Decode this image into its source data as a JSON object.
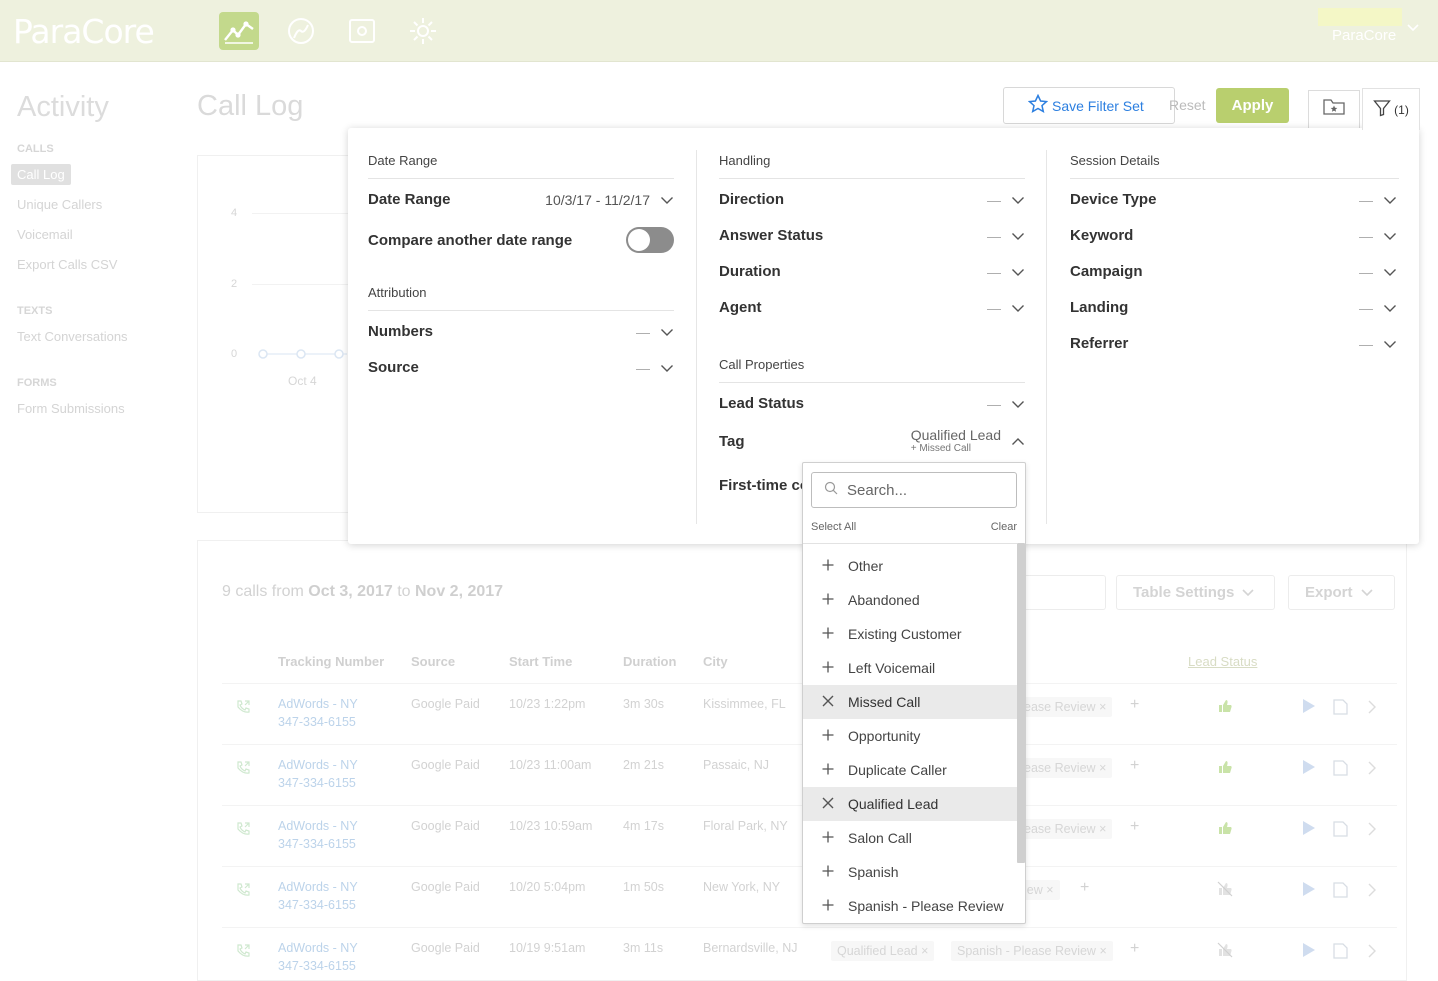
{
  "brand": "ParaCore",
  "account": {
    "name": "ParaCore"
  },
  "sidebar": {
    "title": "Activity",
    "sections": [
      {
        "label": "CALLS",
        "items": [
          "Call Log",
          "Unique Callers",
          "Voicemail",
          "Export Calls CSV"
        ]
      },
      {
        "label": "TEXTS",
        "items": [
          "Text Conversations"
        ]
      },
      {
        "label": "FORMS",
        "items": [
          "Form Submissions"
        ]
      }
    ],
    "active_item": "Call Log"
  },
  "page": {
    "title": "Call Log"
  },
  "toolbar": {
    "save_filter_label": "Save Filter Set",
    "reset_label": "Reset",
    "apply_label": "Apply",
    "filter_count": "(1)"
  },
  "chart": {
    "y_ticks": [
      "4",
      "2",
      "0"
    ],
    "x_ticks": [
      "Oct 4"
    ]
  },
  "filters": {
    "date_range_section": "Date Range",
    "date_range_label": "Date Range",
    "date_range_value": "10/3/17 - 11/2/17",
    "compare_label": "Compare another date range",
    "attribution_section": "Attribution",
    "numbers_label": "Numbers",
    "source_label": "Source",
    "handling_section": "Handling",
    "direction_label": "Direction",
    "answer_status_label": "Answer Status",
    "duration_label": "Duration",
    "agent_label": "Agent",
    "call_props_section": "Call Properties",
    "lead_status_label": "Lead Status",
    "tag_label": "Tag",
    "tag_value": "Qualified Lead",
    "tag_sub": "+ Missed Call",
    "first_time_label": "First-time co",
    "session_section": "Session Details",
    "device_type_label": "Device Type",
    "keyword_label": "Keyword",
    "campaign_label": "Campaign",
    "landing_label": "Landing",
    "referrer_label": "Referrer",
    "empty": "—"
  },
  "tag_dropdown": {
    "search_placeholder": "Search...",
    "select_all": "Select All",
    "clear": "Clear",
    "options": [
      {
        "label": "Other",
        "selected": false
      },
      {
        "label": "Abandoned",
        "selected": false
      },
      {
        "label": "Existing Customer",
        "selected": false
      },
      {
        "label": "Left Voicemail",
        "selected": false
      },
      {
        "label": "Missed Call",
        "selected": true
      },
      {
        "label": "Opportunity",
        "selected": false
      },
      {
        "label": "Duplicate Caller",
        "selected": false
      },
      {
        "label": "Qualified Lead",
        "selected": true
      },
      {
        "label": "Salon Call",
        "selected": false
      },
      {
        "label": "Spanish",
        "selected": false
      },
      {
        "label": "Spanish - Please Review",
        "selected": false
      }
    ]
  },
  "table": {
    "summary_prefix": "9 calls from",
    "summary_start": "Oct 3, 2017",
    "summary_mid": "to",
    "summary_end": "Nov 2, 2017",
    "table_settings_label": "Table Settings",
    "export_label": "Export",
    "columns": [
      "Tracking Number",
      "Source",
      "Start Time",
      "Duration",
      "City",
      "Lead Status"
    ],
    "rows": [
      {
        "tracking": "AdWords - NY",
        "number": "347-334-6155",
        "source": "Google Paid",
        "start": "10/23 1:22pm",
        "duration": "3m 30s",
        "city": "Kissimmee, FL",
        "tags": [
          "ease Review"
        ]
      },
      {
        "tracking": "AdWords - NY",
        "number": "347-334-6155",
        "source": "Google Paid",
        "start": "10/23 11:00am",
        "duration": "2m 21s",
        "city": "Passaic, NJ",
        "tags": [
          "ease Review"
        ]
      },
      {
        "tracking": "AdWords - NY",
        "number": "347-334-6155",
        "source": "Google Paid",
        "start": "10/23 10:59am",
        "duration": "4m 17s",
        "city": "Floral Park, NY",
        "tags": [
          "ease Review"
        ]
      },
      {
        "tracking": "AdWords - NY",
        "number": "347-334-6155",
        "source": "Google Paid",
        "start": "10/20 5:04pm",
        "duration": "1m 50s",
        "city": "New York, NY",
        "tags": [
          "iew"
        ]
      },
      {
        "tracking": "AdWords - NY",
        "number": "347-334-6155",
        "source": "Google Paid",
        "start": "10/19 9:51am",
        "duration": "3m 11s",
        "city": "Bernardsville, NJ",
        "tags": [
          "Qualified Lead",
          "Spanish - Please Review"
        ]
      }
    ]
  }
}
